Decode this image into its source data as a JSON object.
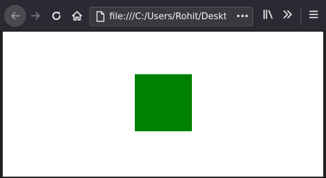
{
  "toolbar": {
    "back_icon": "back-arrow-icon",
    "forward_icon": "forward-arrow-icon",
    "reload_icon": "reload-icon",
    "home_icon": "home-icon",
    "url": "file:///C:/Users/Rohit/Desktop/HT",
    "page_icon": "page-icon",
    "page_actions_label": "•••",
    "library_icon": "library-icon",
    "overflow_icon": "chevron-double-right-icon",
    "menu_icon": "hamburger-menu-icon",
    "colors": {
      "toolbar_bg": "#2b2a33",
      "urlbar_bg": "#3a3940",
      "icon": "#e6e6ea"
    }
  },
  "page": {
    "background": "#ffffff",
    "box_color": "#008000"
  }
}
